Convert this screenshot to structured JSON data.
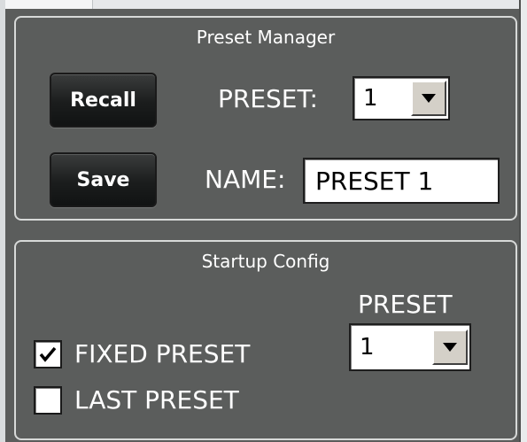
{
  "preset_manager": {
    "title": "Preset Manager",
    "recall_label": "Recall",
    "save_label": "Save",
    "preset_label": "PRESET:",
    "preset_value": "1",
    "name_label": "NAME:",
    "name_value": "PRESET 1"
  },
  "startup_config": {
    "title": "Startup Config",
    "preset_label": "PRESET",
    "preset_value": "1",
    "options": [
      {
        "label": "FIXED PRESET",
        "checked": true
      },
      {
        "label": "LAST PRESET",
        "checked": false
      }
    ]
  },
  "icons": {
    "dropdown": "triangle-down-icon",
    "check": "checkmark-icon"
  }
}
